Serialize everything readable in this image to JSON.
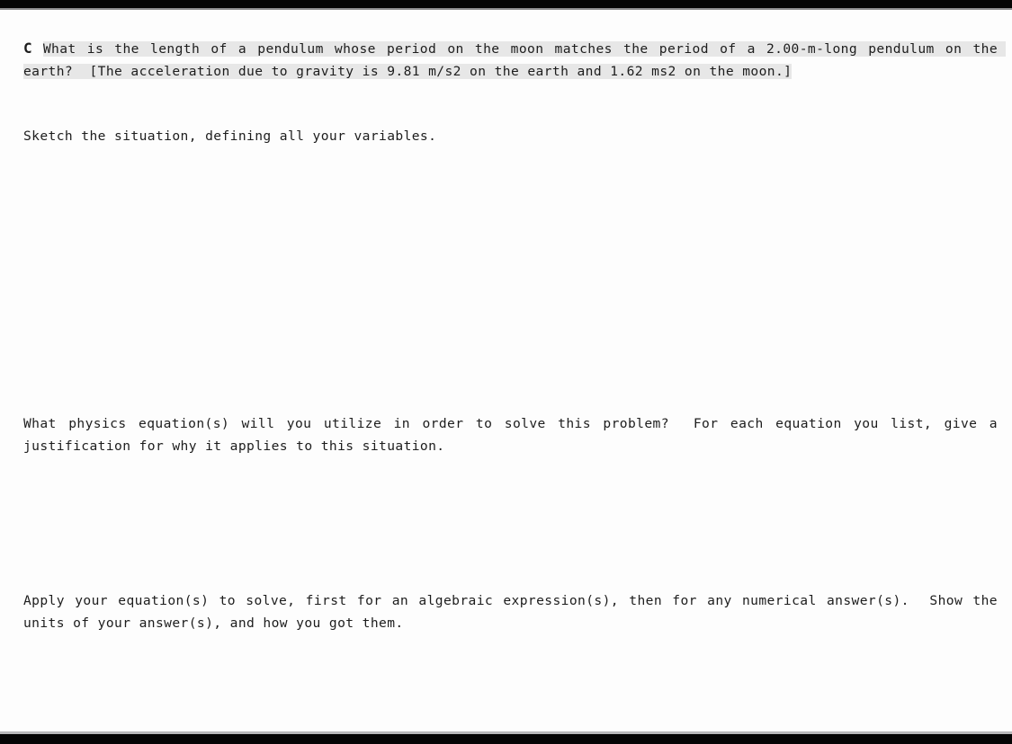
{
  "document": {
    "type": "physics-worksheet-scan",
    "question_label": "C",
    "problem_statement": "What is the length of a pendulum whose period on the moon matches the period of a 2.00-m-long pendulum on the earth?  [The acceleration due to gravity is 9.81 m/s2 on the earth and 1.62 ms2 on the moon.]",
    "prompts": {
      "sketch": "Sketch the situation, defining all your variables.",
      "equations": "What physics equation(s) will you utilize in order to solve this problem?  For each equation you list, give a justification for why it applies to this situation.",
      "apply": "Apply your equation(s) to solve, first for an algebraic expression(s), then for any numerical answer(s).  Show the units of your answer(s), and how you got them."
    },
    "values": {
      "pendulum_length_earth": "2.00-m",
      "gravity_earth": "9.81 m/s2",
      "gravity_moon": "1.62 ms2"
    },
    "colors": {
      "highlight": "#e7e7e7",
      "text": "#1d1d1d",
      "page": "#fdfdfd",
      "scan_bar": "#050505"
    }
  }
}
